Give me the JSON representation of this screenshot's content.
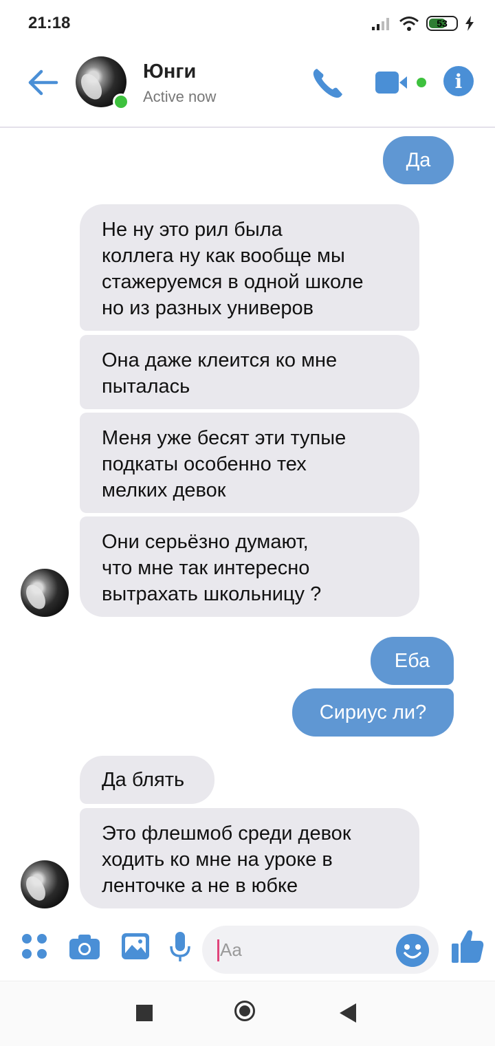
{
  "status_bar": {
    "time": "21:18",
    "battery": "53"
  },
  "header": {
    "name": "Юнги",
    "status": "Active now",
    "accent_color": "#4a8fd6",
    "online_color": "#3ec13e"
  },
  "messages": [
    {
      "dir": "out",
      "text": "Да"
    },
    {
      "dir": "in",
      "lines": [
        "Не ну это рил была",
        "коллега ну как вообще мы",
        "стажеруемся в одной школе",
        "но из разных универов"
      ]
    },
    {
      "dir": "in",
      "lines": [
        "Она даже клеится ко мне",
        "пыталась"
      ]
    },
    {
      "dir": "in",
      "lines": [
        "Меня уже бесят эти тупые",
        "подкаты особенно тех",
        "мелких девок"
      ]
    },
    {
      "dir": "in",
      "lines": [
        "Они серьёзно думают,",
        "что мне так интересно",
        "вытрахать школьницу ?"
      ]
    },
    {
      "dir": "out",
      "text": "Еба"
    },
    {
      "dir": "out",
      "text": "Сириус ли?"
    },
    {
      "dir": "in",
      "lines": [
        "Да блять"
      ]
    },
    {
      "dir": "in",
      "lines": [
        "Это флешмоб среди девок",
        "ходить ко мне на уроке в",
        "ленточке а не в юбке"
      ]
    }
  ],
  "composer": {
    "placeholder": "Aa"
  }
}
